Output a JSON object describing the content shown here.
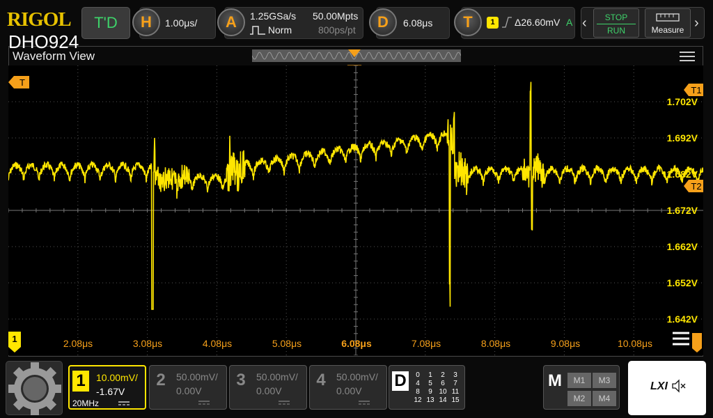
{
  "header": {
    "brand": "RIGOL",
    "model": "DHO924",
    "td_label": "T'D",
    "horizontal": {
      "badge": "H",
      "timebase": "1.00μs/"
    },
    "acquire": {
      "badge": "A",
      "sample_rate": "1.25GSa/s",
      "mode": "Norm",
      "memory": "50.00Mpts",
      "resolution": "800ps/pt"
    },
    "delay": {
      "badge": "D",
      "value": "6.08μs"
    },
    "trigger": {
      "badge": "T",
      "channel": "1",
      "level": "Δ26.60mV",
      "mode": "A"
    },
    "run": {
      "stop_label": "STOP",
      "run_label": "RUN"
    },
    "measure_label": "Measure"
  },
  "waveform_view": {
    "title": "Waveform View",
    "trigger_marker": "T",
    "cursor_t1": "T1",
    "cursor_t2": "T2",
    "channel_marker": "1",
    "y_labels": [
      "1.702V",
      "1.692V",
      "1.682V",
      "1.672V",
      "1.662V",
      "1.652V",
      "1.642V"
    ],
    "x_labels": [
      "2.08μs",
      "3.08μs",
      "4.08μs",
      "5.08μs",
      "6.08μs",
      "7.08μs",
      "8.08μs",
      "9.08μs",
      "10.08μs"
    ]
  },
  "channels": [
    {
      "num": "1",
      "scale": "10.00mV/",
      "offset": "-1.67V",
      "bw": "20MHz",
      "active": true
    },
    {
      "num": "2",
      "scale": "50.00mV/",
      "offset": "0.00V",
      "active": false
    },
    {
      "num": "3",
      "scale": "50.00mV/",
      "offset": "0.00V",
      "active": false
    },
    {
      "num": "4",
      "scale": "50.00mV/",
      "offset": "0.00V",
      "active": false
    }
  ],
  "digital": {
    "label": "D",
    "rows": [
      [
        "0",
        "1",
        "2",
        "3"
      ],
      [
        "4",
        "5",
        "6",
        "7"
      ],
      [
        "8",
        "9",
        "10",
        "11"
      ],
      [
        "12",
        "13",
        "14",
        "15"
      ]
    ]
  },
  "math": {
    "label": "M",
    "buttons": [
      "M1",
      "M3",
      "M2",
      "M4"
    ]
  },
  "lxi": {
    "label": "LXI"
  },
  "colors": {
    "ch1": "#ffe600",
    "accent": "#f6a01a",
    "run_green": "#3ed26a"
  }
}
